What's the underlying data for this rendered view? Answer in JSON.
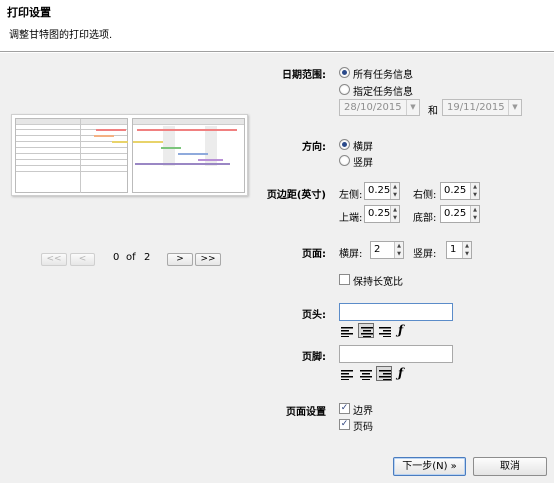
{
  "header": {
    "title": "打印设置",
    "subtitle": "调整甘特图的打印选项."
  },
  "preview": {
    "left_header_1": "任务",
    "left_header_2": "开始日期",
    "left_rows": [
      "项目计划",
      "- 需求调查",
      "- 评估",
      "- 概要设计",
      "- 详细设计",
      "- 系统测试",
      "- 完成"
    ],
    "right_header": "二月份"
  },
  "pager": {
    "first": "<<",
    "prev": "<",
    "current": "0",
    "of": "of",
    "total": "2",
    "next": ">",
    "last": ">>"
  },
  "date_range": {
    "label": "日期范围:",
    "option_all": "所有任务信息",
    "option_specified": "指定任务信息",
    "start": "28/10/2015",
    "and": "和",
    "end": "19/11/2015"
  },
  "orientation": {
    "label": "方向:",
    "landscape": "横屏",
    "portrait": "竖屏"
  },
  "margins": {
    "label": "页边距(英寸)",
    "left_label": "左侧:",
    "left": "0.25",
    "right_label": "右侧:",
    "right": "0.25",
    "top_label": "上端:",
    "top": "0.25",
    "bottom_label": "底部:",
    "bottom": "0.25"
  },
  "pages": {
    "label": "页面:",
    "horizontal_label": "横屏:",
    "horizontal": "2",
    "vertical_label": "竖屏:",
    "vertical": "1",
    "keep_ratio": "保持长宽比"
  },
  "page_header": {
    "label": "页头:",
    "value": ""
  },
  "page_footer": {
    "label": "页脚:",
    "value": ""
  },
  "page_settings": {
    "label": "页面设置",
    "border": "边界",
    "page_number": "页码"
  },
  "buttons": {
    "next": "下一步(N) »",
    "cancel": "取消"
  },
  "colors": {
    "bar_red": "#f08080",
    "bar_orange": "#f4b183",
    "bar_yellow": "#e8d36a",
    "bar_green": "#7cc57c",
    "bar_purple": "#b88fd6",
    "bar_blue": "#8faadc"
  }
}
